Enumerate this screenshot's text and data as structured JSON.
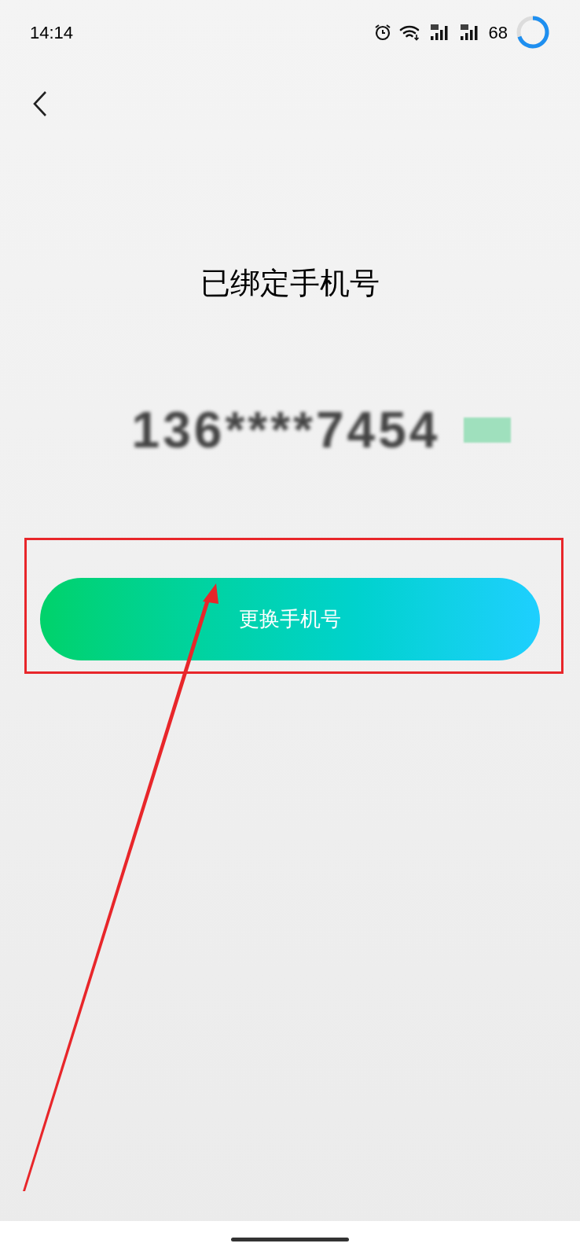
{
  "status_bar": {
    "time": "14:14",
    "battery": "68"
  },
  "title": "已绑定手机号",
  "phone_number": "136****7454",
  "change_button": {
    "label": "更换手机号"
  }
}
